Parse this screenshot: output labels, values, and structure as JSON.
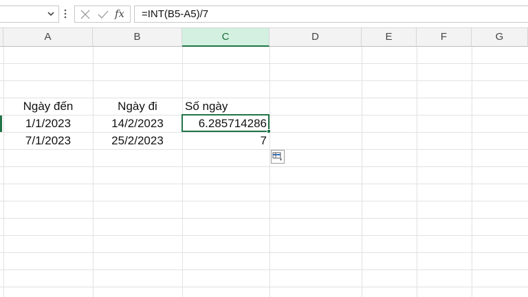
{
  "formula_bar": {
    "formula": "=INT(B5-A5)/7",
    "fx_label": "fx",
    "cancel_icon": "close-icon",
    "enter_icon": "check-icon"
  },
  "columns": [
    "A",
    "B",
    "C",
    "D",
    "E",
    "F",
    "G"
  ],
  "selected_column": "C",
  "headers_row": {
    "a": "Ngày đến",
    "b": "Ngày đi",
    "c": "Số ngày"
  },
  "rows": [
    {
      "a": "1/1/2023",
      "b": "14/2/2023",
      "c": "6.285714286"
    },
    {
      "a": "7/1/2023",
      "b": "25/2/2023",
      "c": "7"
    }
  ],
  "colors": {
    "accent": "#217346",
    "selected_header_bg": "#d3f0e0",
    "gridline": "#e1e1e1"
  },
  "icons": {
    "namebox_dropdown": "chevron-down-icon",
    "more": "more-vertical-icon",
    "quick_analysis": "quick-analysis-icon"
  }
}
